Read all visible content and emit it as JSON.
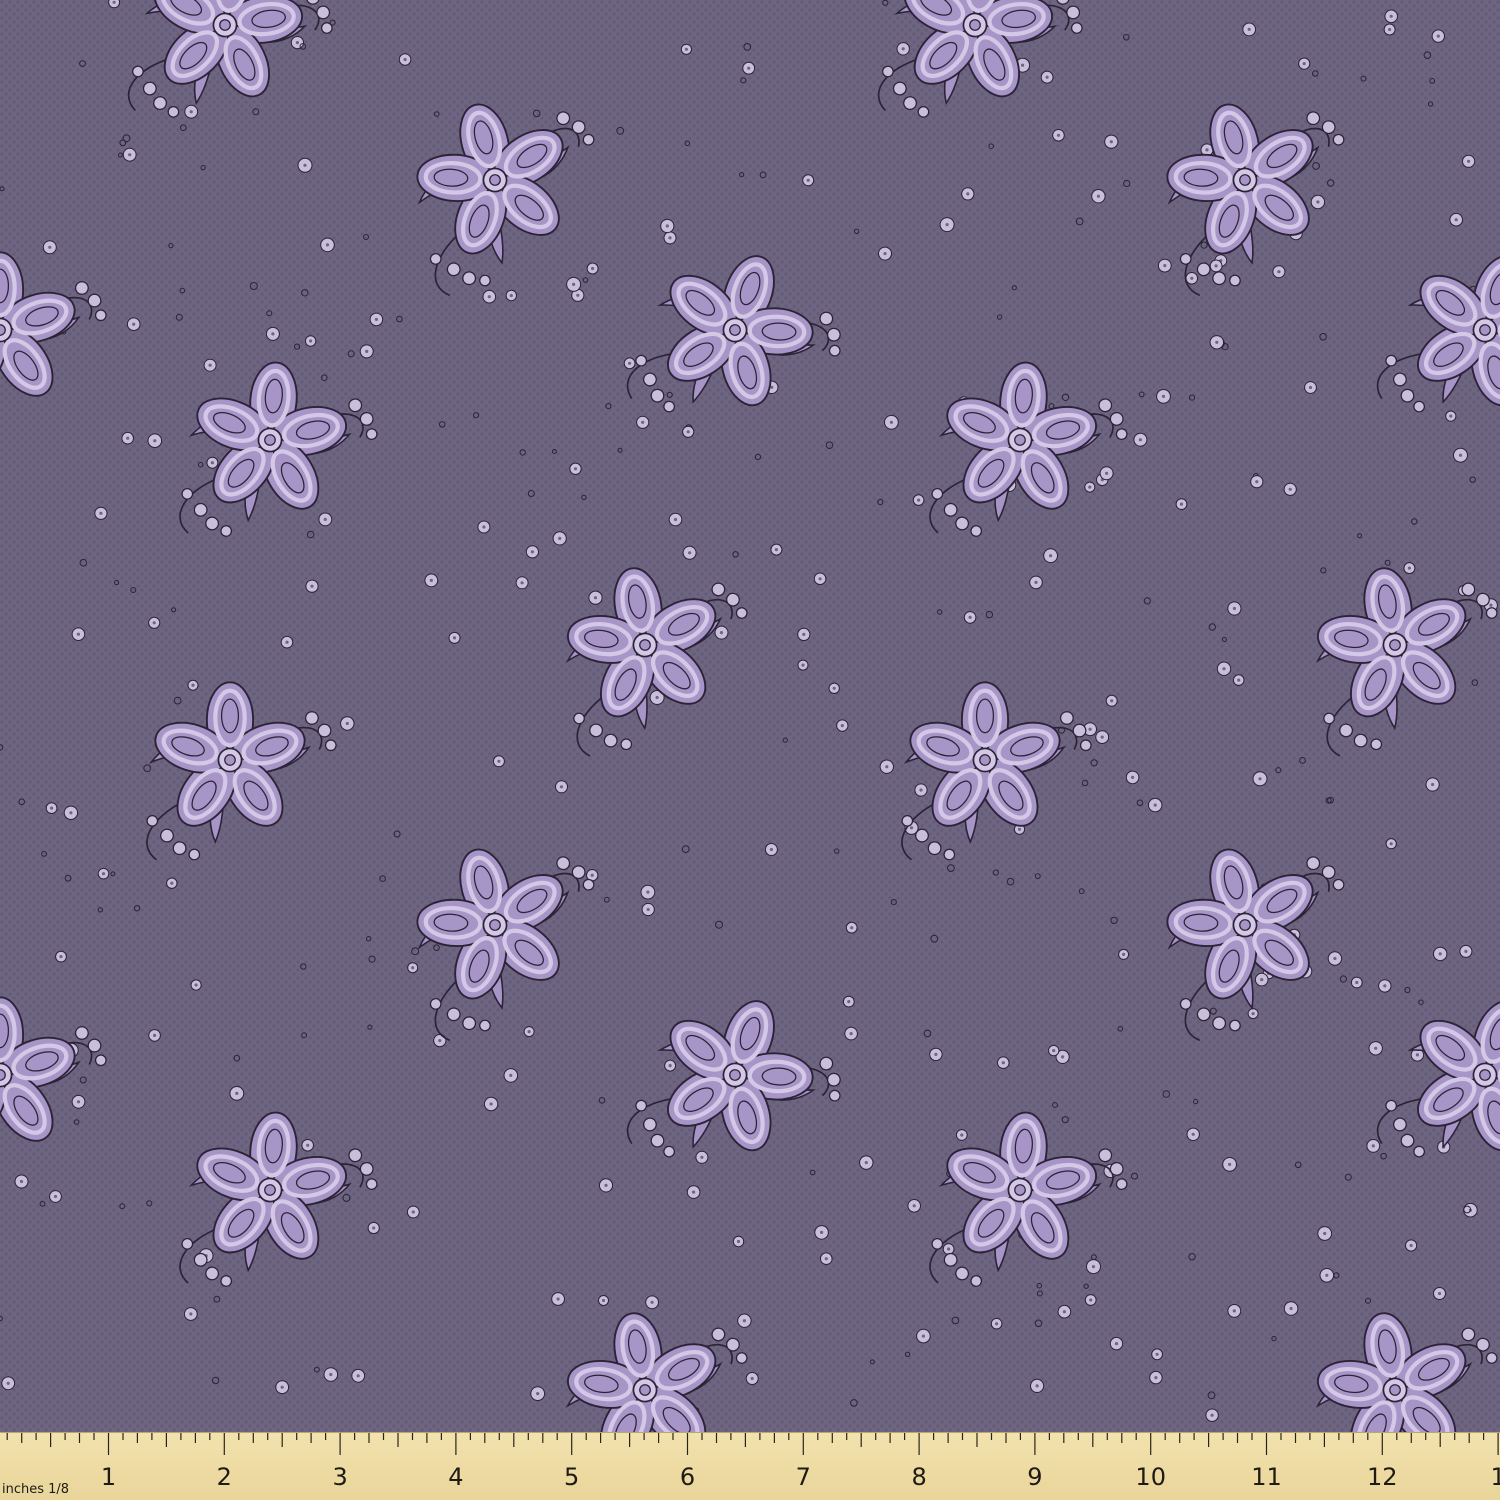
{
  "colors": {
    "background": "#6e6582",
    "weave_dark": "#645b77",
    "petal": "#a795c8",
    "petal_light": "#d3c8e6",
    "outline": "#2b2336",
    "dot_fill": "#c9bedb",
    "ruler": "#efdfaa"
  },
  "ruler": {
    "unit_label": "inches 1/8",
    "numbers": [
      "1",
      "2",
      "3",
      "4",
      "5",
      "6",
      "7",
      "8",
      "9",
      "10",
      "11",
      "12",
      "1"
    ]
  }
}
